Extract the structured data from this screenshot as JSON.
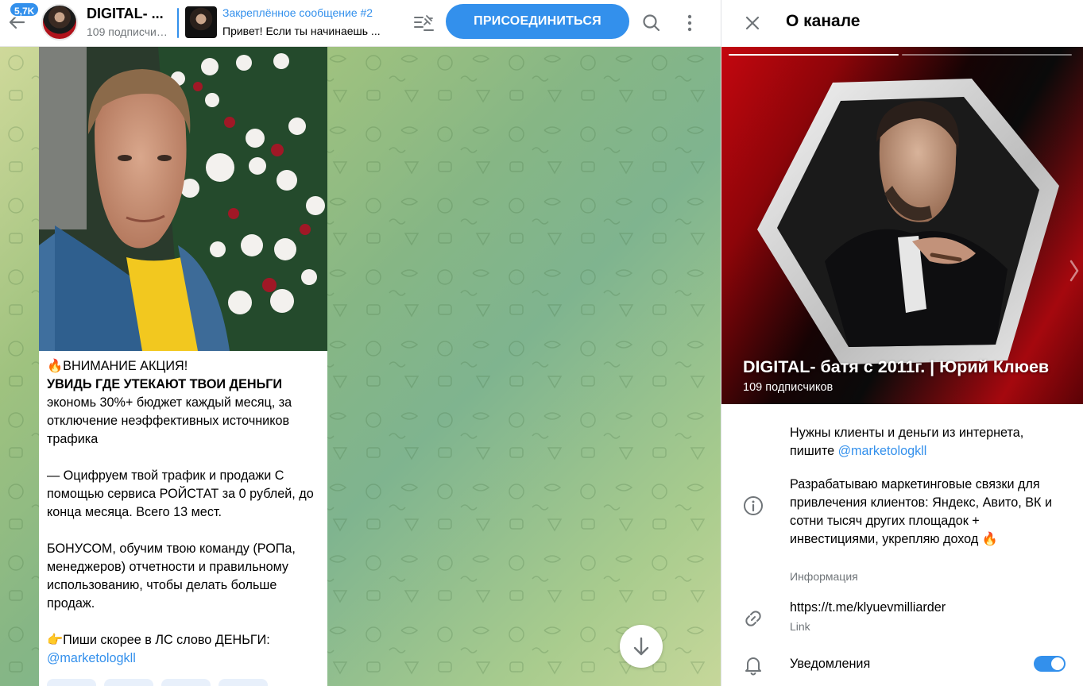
{
  "header": {
    "unread_badge": "5,7K",
    "channel_title": "DIGITAL- ...",
    "channel_subtitle": "109 подписчиков",
    "pinned_title": "Закреплённое сообщение #2",
    "pinned_text": "Привет! Если ты начинаешь ...",
    "join_label": "ПРИСОЕДИНИТЬСЯ"
  },
  "message": {
    "lines": [
      {
        "text": "🔥ВНИМАНИЕ АКЦИЯ!",
        "style": "normal"
      },
      {
        "text": "УВИДЬ ГДЕ УТЕКАЮТ ТВОИ ДЕНЬГИ",
        "style": "bold"
      },
      {
        "text": "экономь 30%+ бюджет каждый месяц, за отключение неэффективных источников трафика",
        "style": "normal"
      },
      {
        "text": "",
        "style": "normal"
      },
      {
        "text": "— Оцифруем твой трафик и продажи С помощью сервиса РОЙСТАТ за 0 рублей, до конца месяца. Всего 13 мест.",
        "style": "normal"
      },
      {
        "text": "",
        "style": "normal"
      },
      {
        "text": "БОНУСОМ, обучим твою команду (РОПа, менеджеров) отчетности и правильному использованию, чтобы делать больше продаж.",
        "style": "normal"
      },
      {
        "text": "",
        "style": "normal"
      },
      {
        "text": "👉Пиши скорее в ЛС слово ДЕНЬГИ:",
        "style": "normal"
      },
      {
        "text": "@marketologkll",
        "style": "link"
      }
    ]
  },
  "panel": {
    "title": "О канале",
    "cover_title": "DIGITAL- батя с 2011г. | Юрий Клюев",
    "cover_subtitle": "109 подписчиков",
    "desc_part1": "Нужны клиенты и деньги из интернета, пишите ",
    "desc_link": "@marketologkll",
    "desc_part2": "Разрабатываю маркетинговые связки для привлечения клиентов: Яндекс, Авито, ВК и сотни тысяч других площадок + инвестициями, укрепляю доход 🔥",
    "info_caption": "Информация",
    "link_value": "https://t.me/klyuevmilliarder",
    "link_caption": "Link",
    "notifications_label": "Уведомления",
    "notifications_on": true
  },
  "icons": {
    "back": "arrow-left-icon",
    "pin_list": "pinned-list-icon",
    "search": "search-icon",
    "more": "more-vertical-icon",
    "close": "close-icon",
    "info": "info-icon",
    "link": "link-icon",
    "bell": "bell-icon",
    "scroll": "arrow-down-icon"
  },
  "colors": {
    "accent": "#3390ec",
    "secondary_text": "#707579",
    "cover_red": "#c4060f"
  }
}
